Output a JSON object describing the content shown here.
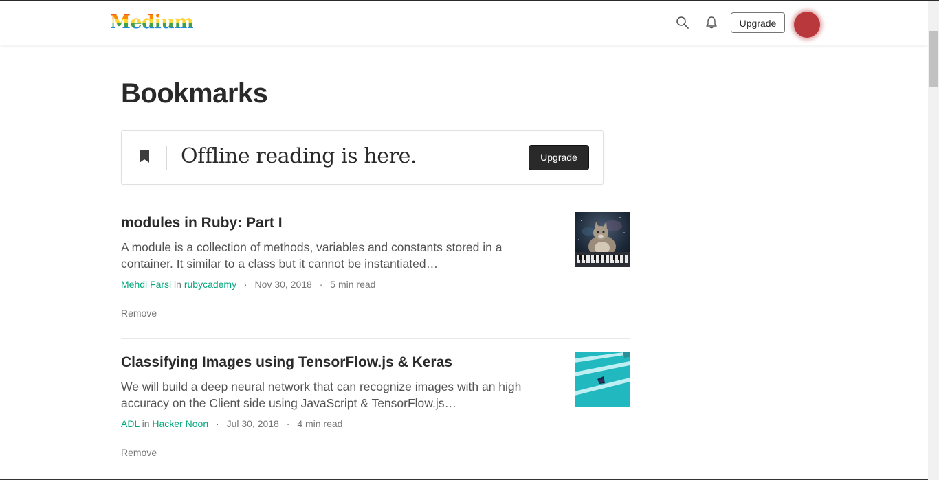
{
  "header": {
    "logo_text": "Medium",
    "upgrade_label": "Upgrade",
    "search_icon": "search-icon",
    "notifications_icon": "bell-icon"
  },
  "page": {
    "title": "Bookmarks"
  },
  "promo": {
    "icon": "bookmark-icon",
    "text": "Offline reading is here.",
    "button_label": "Upgrade"
  },
  "articles": [
    {
      "title": "modules in Ruby: Part I",
      "excerpt": "A module is a collection of methods, variables and constants stored in a container. It similar to a class but it cannot be instantiated…",
      "author": "Mehdi Farsi",
      "in_text": "in",
      "publication": "rubycademy",
      "date": "Nov 30, 2018",
      "read_time": "5 min read",
      "remove_label": "Remove",
      "thumbnail": "cat-keyboard-space-thumbnail"
    },
    {
      "title": "Classifying Images using TensorFlow.js & Keras",
      "excerpt": "We will build a deep neural network that can recognize images with an high accuracy on the Client side using JavaScript & TensorFlow.js…",
      "author": "ADL",
      "in_text": "in",
      "publication": "Hacker Noon",
      "date": "Jul 30, 2018",
      "read_time": "4 min read",
      "remove_label": "Remove",
      "thumbnail": "teal-pixel-thumbnail"
    }
  ],
  "meta_separator": "·",
  "colors": {
    "accent_green": "#03a87c",
    "avatar": "#b8383c",
    "button_dark": "#292929"
  }
}
